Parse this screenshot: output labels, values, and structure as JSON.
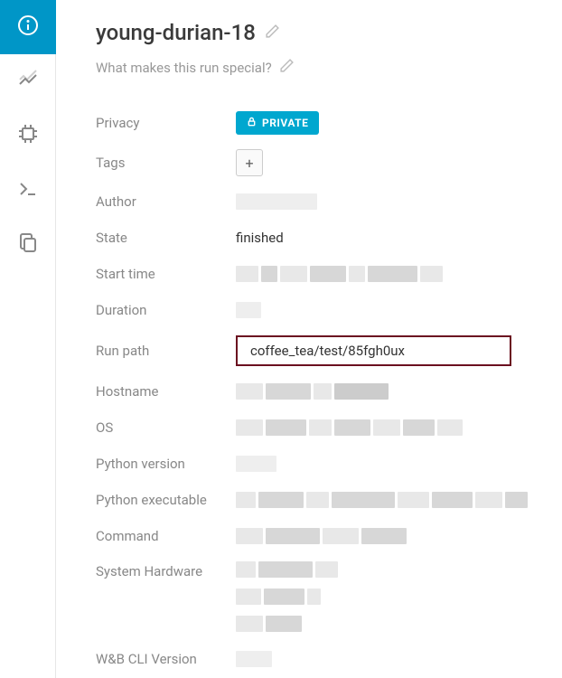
{
  "run": {
    "title": "young-durian-18",
    "description_placeholder": "What makes this run special?"
  },
  "fields": {
    "privacy": {
      "label": "Privacy",
      "badge": "PRIVATE"
    },
    "tags": {
      "label": "Tags",
      "add_symbol": "+"
    },
    "author": {
      "label": "Author"
    },
    "state": {
      "label": "State",
      "value": "finished"
    },
    "start_time": {
      "label": "Start time"
    },
    "duration": {
      "label": "Duration"
    },
    "run_path": {
      "label": "Run path",
      "value": "coffee_tea/test/85fgh0ux"
    },
    "hostname": {
      "label": "Hostname"
    },
    "os": {
      "label": "OS"
    },
    "python_version": {
      "label": "Python version"
    },
    "python_executable": {
      "label": "Python executable"
    },
    "command": {
      "label": "Command"
    },
    "system_hardware": {
      "label": "System Hardware"
    },
    "wb_cli_version": {
      "label": "W&B CLI Version"
    }
  }
}
